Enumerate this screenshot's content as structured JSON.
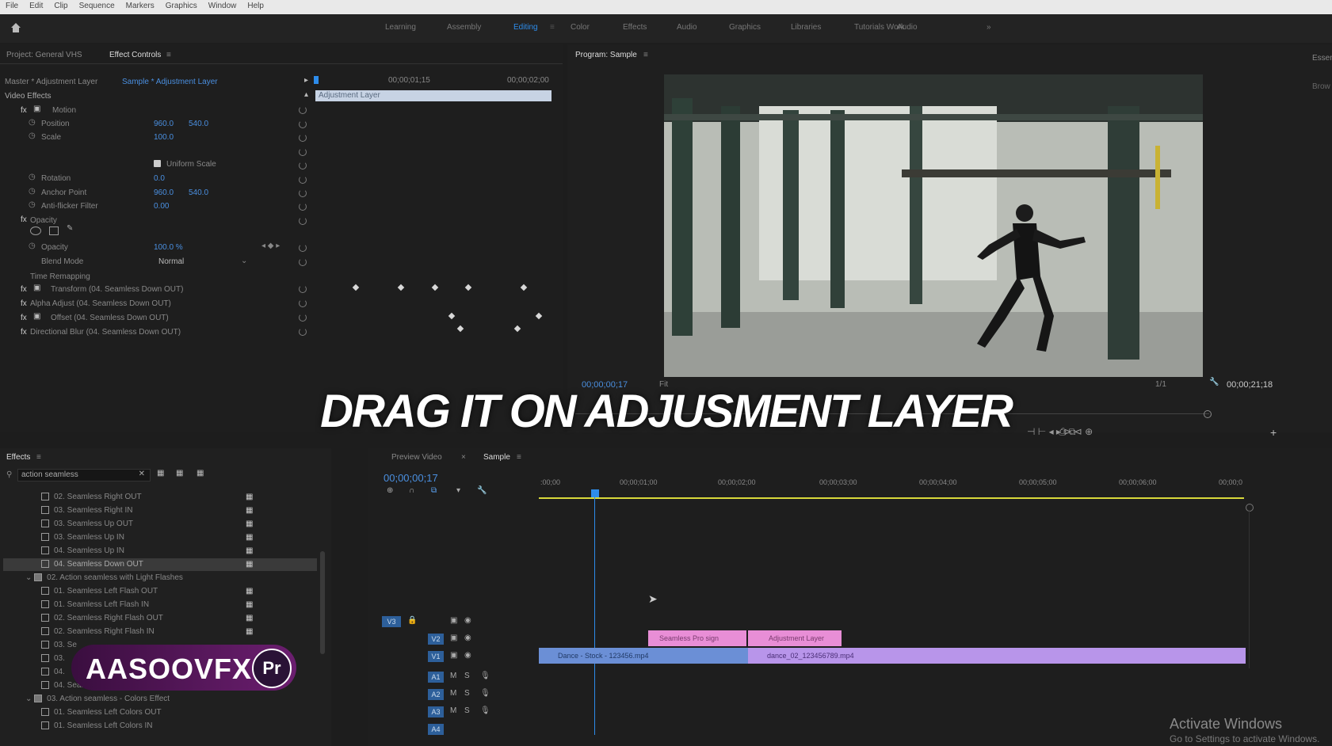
{
  "menu": [
    "File",
    "Edit",
    "Clip",
    "Sequence",
    "Markers",
    "Graphics",
    "Window",
    "Help"
  ],
  "workspaces": [
    "Learning",
    "Assembly",
    "Editing",
    "Color",
    "Effects",
    "Audio",
    "Graphics",
    "Libraries",
    "»"
  ],
  "workspaces_extra": [
    "Tutorials Work",
    "Audio"
  ],
  "active_workspace": "Editing",
  "effect_controls": {
    "tabs": [
      "Project: General VHS",
      "Effect Controls"
    ],
    "master": "Master * Adjustment Layer",
    "clip": "Sample * Adjustment Layer",
    "tc_mid": "00;00;01;15",
    "tc_end": "00;00;02;00",
    "clip_bar_label": "Adjustment Layer",
    "video_effects": "Video Effects",
    "motion": "Motion",
    "position_label": "Position",
    "position_x": "960.0",
    "position_y": "540.0",
    "scale_label": "Scale",
    "scale_value": "100.0",
    "uniform_scale": "Uniform Scale",
    "rotation_label": "Rotation",
    "rotation_value": "0.0",
    "anchor_label": "Anchor Point",
    "anchor_x": "960.0",
    "anchor_y": "540.0",
    "antiflicker_label": "Anti-flicker Filter",
    "antiflicker_value": "0.00",
    "opacity_group": "Opacity",
    "opacity_label": "Opacity",
    "opacity_value": "100.0 %",
    "blend_label": "Blend Mode",
    "blend_value": "Normal",
    "time_remap": "Time Remapping",
    "fx1": "Transform (04. Seamless Down OUT)",
    "fx2": "Alpha Adjust (04. Seamless Down OUT)",
    "fx3": "Offset (04. Seamless Down OUT)",
    "fx4": "Directional Blur (04. Seamless Down OUT)"
  },
  "program": {
    "title": "Program: Sample",
    "timecode": "00;00;00;17",
    "fit": "Fit",
    "ratio": "1/1",
    "duration": "00;00;21;18"
  },
  "overlay_text": "DRAG IT ON ADJUSMENT LAYER",
  "effects_panel": {
    "tab": "Effects",
    "search_value": "action seamless",
    "items": [
      "02. Seamless Right OUT",
      "03. Seamless Right IN",
      "03. Seamless Up OUT",
      "03. Seamless Up IN",
      "04. Seamless Up IN",
      "04. Seamless Down OUT",
      "02. Action seamless with Light Flashes",
      "01. Seamless Left Flash OUT",
      "01. Seamless Left Flash IN",
      "02. Seamless Right Flash OUT",
      "02. Seamless Right Flash IN",
      "03. Se",
      "03.",
      "04.",
      "04. Seamless Down Flash IN",
      "03. Action seamless - Colors Effect",
      "01. Seamless Left Colors OUT",
      "01. Seamless Left Colors IN"
    ]
  },
  "timeline": {
    "tabs": [
      "Preview Video",
      "Sample"
    ],
    "timecode": "00;00;00;17",
    "ruler": [
      ":00;00",
      "00;00;01;00",
      "00;00;02;00",
      "00;00;03;00",
      "00;00;04;00",
      "00;00;05;00",
      "00;00;06;00",
      "00;00;0"
    ],
    "clip_v3a": "Seamless Pro sign",
    "clip_v3b": "Adjustment Layer",
    "clip_v1a": "Dance - Stock - 123456.mp4",
    "clip_v1b": "dance_02_123456789.mp4",
    "tracks_v": [
      "V3",
      "V2",
      "V1"
    ],
    "tracks_a": [
      "A1",
      "A2",
      "A3",
      "A4"
    ]
  },
  "logo": {
    "text": "AASOOVFX",
    "badge": "Pr"
  },
  "activate": {
    "title": "Activate Windows",
    "subtitle": "Go to Settings to activate Windows."
  },
  "right_edge": [
    "Essen",
    "Brow"
  ],
  "colors": {
    "accent": "#2d8ceb",
    "clip_pink": "#e88ed6",
    "clip_purple": "#b895ea",
    "clip_blue": "#6b8fd6"
  }
}
